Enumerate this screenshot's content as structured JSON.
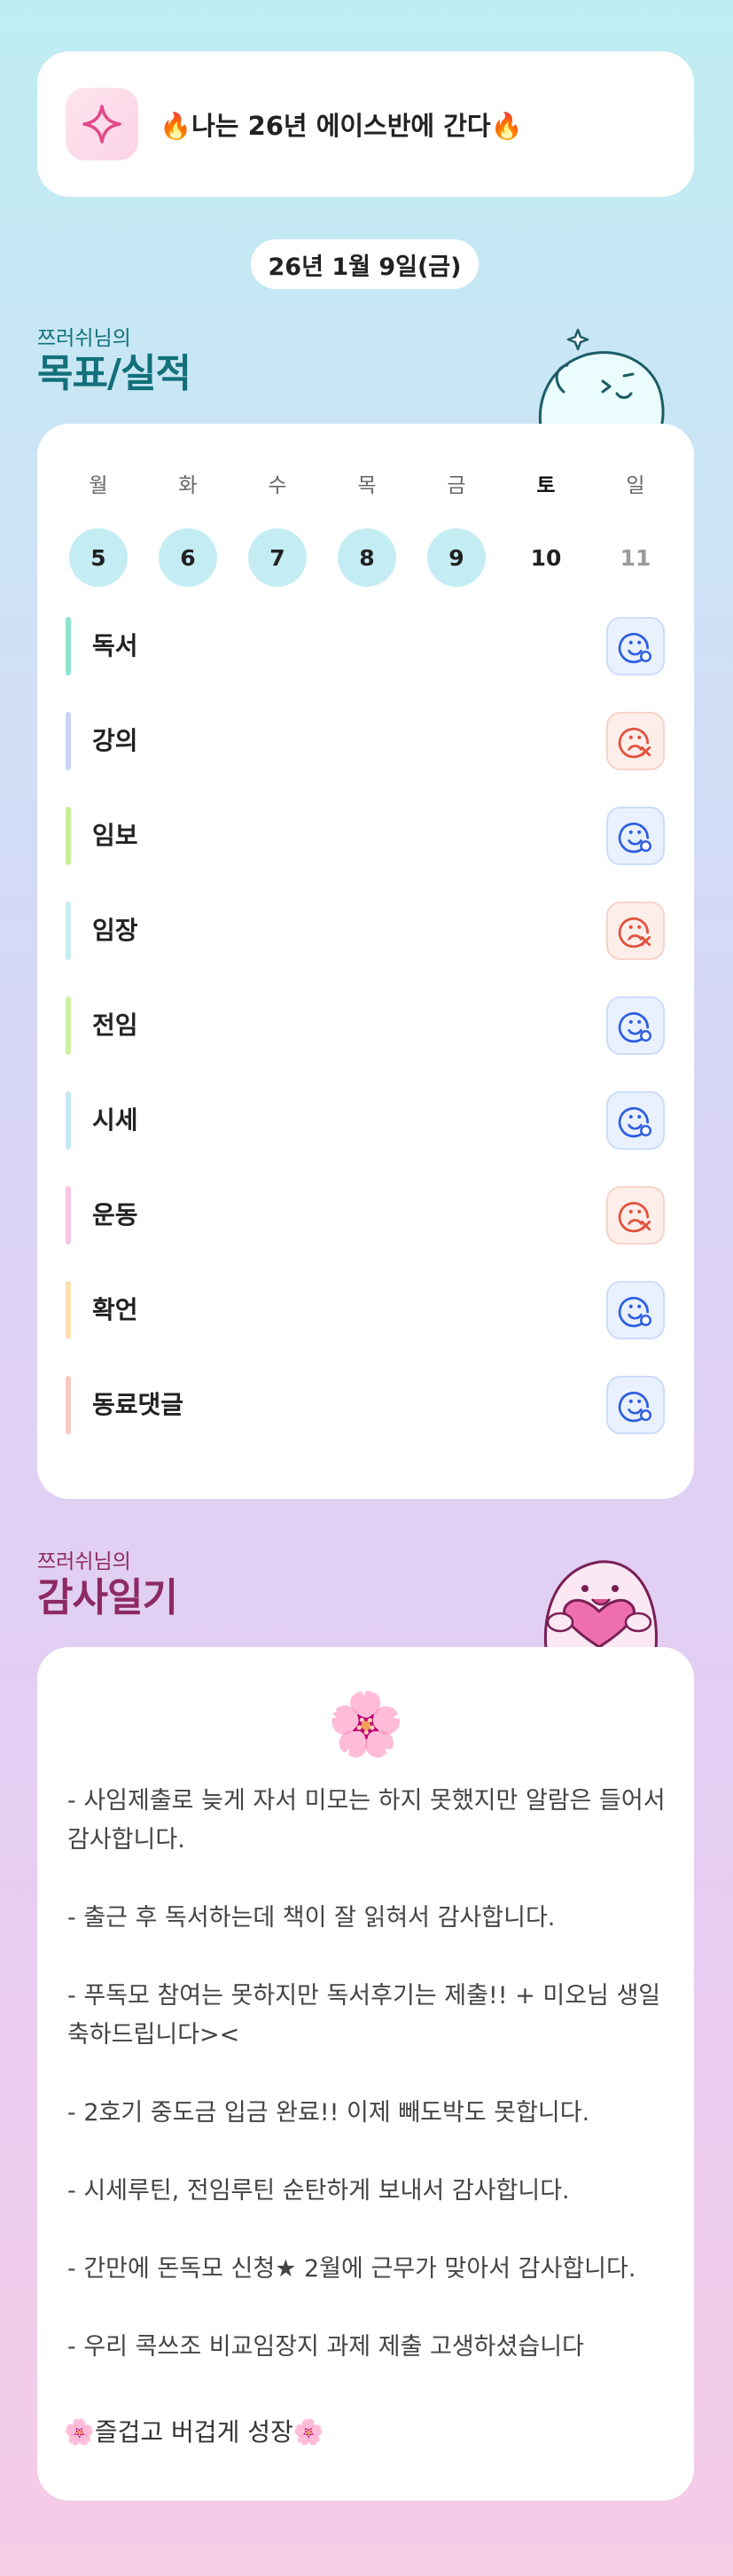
{
  "goal": {
    "text": "🔥나는 26년 에이스반에 간다🔥",
    "icon": "sparkle-icon"
  },
  "date_label": "26년 1월 9일(금)",
  "records_section": {
    "subtitle": "쯔러쉬님의",
    "title": "목표/실적"
  },
  "week": {
    "days": [
      {
        "name": "월",
        "num": "5"
      },
      {
        "name": "화",
        "num": "6"
      },
      {
        "name": "수",
        "num": "7"
      },
      {
        "name": "목",
        "num": "8"
      },
      {
        "name": "금",
        "num": "9"
      },
      {
        "name": "토",
        "num": "10"
      },
      {
        "name": "일",
        "num": "11"
      }
    ]
  },
  "items": [
    {
      "label": "독서",
      "status": "good",
      "color": "#8ee3cf"
    },
    {
      "label": "강의",
      "status": "bad",
      "color": "#c9d4f3"
    },
    {
      "label": "임보",
      "status": "good",
      "color": "#c9ee9a"
    },
    {
      "label": "임장",
      "status": "bad",
      "color": "#c6ecf4"
    },
    {
      "label": "전임",
      "status": "good",
      "color": "#cdf0a0"
    },
    {
      "label": "시세",
      "status": "good",
      "color": "#c4e9f3"
    },
    {
      "label": "운동",
      "status": "bad",
      "color": "#f6c6e2"
    },
    {
      "label": "확언",
      "status": "good",
      "color": "#fbdfb3"
    },
    {
      "label": "동료댓글",
      "status": "good",
      "color": "#f8c9c0"
    }
  ],
  "colors": {
    "good": "#2f5fe0",
    "bad": "#e0523e"
  },
  "diary_section": {
    "subtitle": "쯔러쉬님의",
    "title": "감사일기"
  },
  "diary": {
    "flower": "🌸",
    "text": "- 사임제출로 늦게 자서 미모는 하지 못했지만 알람은 들어서 감사합니다.\n\n- 출근 후 독서하는데 책이 잘 읽혀서 감사합니다.\n\n- 푸독모 참여는 못하지만 독서후기는 제출!! + 미오님 생일 축하드립니다><\n\n- 2호기 중도금 입금 완료!! 이제 빼도박도 못합니다.\n\n- 시세루틴, 전임루틴 순탄하게 보내서 감사합니다.\n\n- 간만에 돈독모 신청★ 2월에 근무가 맞아서 감사합니다.\n\n- 우리 콕쓰조 비교임장지 과제 제출 고생하셨습니다",
    "closing": "🌸즐겁고 버겁게 성장🌸"
  }
}
